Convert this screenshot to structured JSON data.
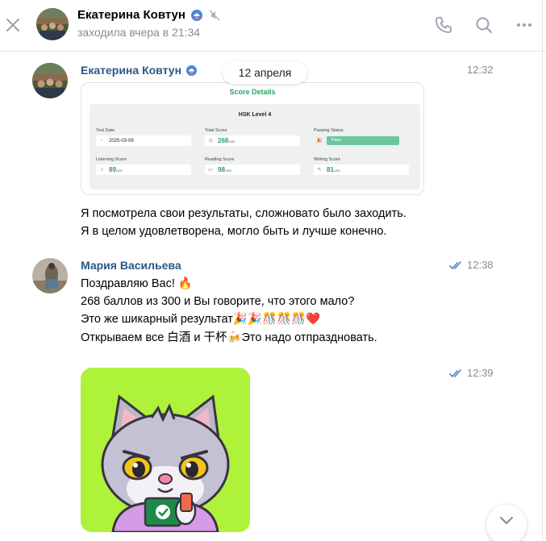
{
  "header": {
    "contact_name": "Екатерина Ковтун",
    "status": "заходила вчера в 21:34",
    "icons": [
      "close-icon",
      "premium-badge-icon",
      "muted-icon",
      "phone-icon",
      "search-icon",
      "more-icon"
    ]
  },
  "date_separator": "12 апреля",
  "messages": [
    {
      "author": "Екатерина Ковтун",
      "time": "12:32",
      "attachment": {
        "title": "Score Details",
        "level": "HSK Level 4",
        "fields": {
          "test_date": {
            "label": "Test Date",
            "value": "2025-03-09"
          },
          "total_score": {
            "label": "Total Score",
            "value": "268",
            "max": "/300"
          },
          "passing_status": {
            "label": "Passing Status",
            "value": "Pass"
          },
          "listening": {
            "label": "Listening Score",
            "value": "89",
            "max": "/100"
          },
          "reading": {
            "label": "Reading Score",
            "value": "98",
            "max": "/100"
          },
          "writing": {
            "label": "Writing Score",
            "value": "81",
            "max": "/100"
          }
        }
      },
      "lines": [
        "Я посмотрела свои результаты, сложновато было заходить.",
        "Я в целом удовлетворена, могло быть и лучше конечно."
      ]
    },
    {
      "author": "Мария Васильева",
      "time": "12:38",
      "lines": [
        "Поздравляю Вас! 🔥",
        "268 баллов из 300 и Вы говорите, что этого мало?",
        "Это же шикарный результат🎉🎉🎊🎊🎊❤️",
        "Открываем все 白酒 и 干杯🍻Это надо отпраздновать."
      ]
    },
    {
      "time": "12:39",
      "sticker": "cat-sticker"
    }
  ],
  "colors": {
    "author": "#2a5885",
    "muted_text": "#818c99",
    "accent_green": "#2e9e68",
    "sticker_bg": "#aef23a"
  }
}
